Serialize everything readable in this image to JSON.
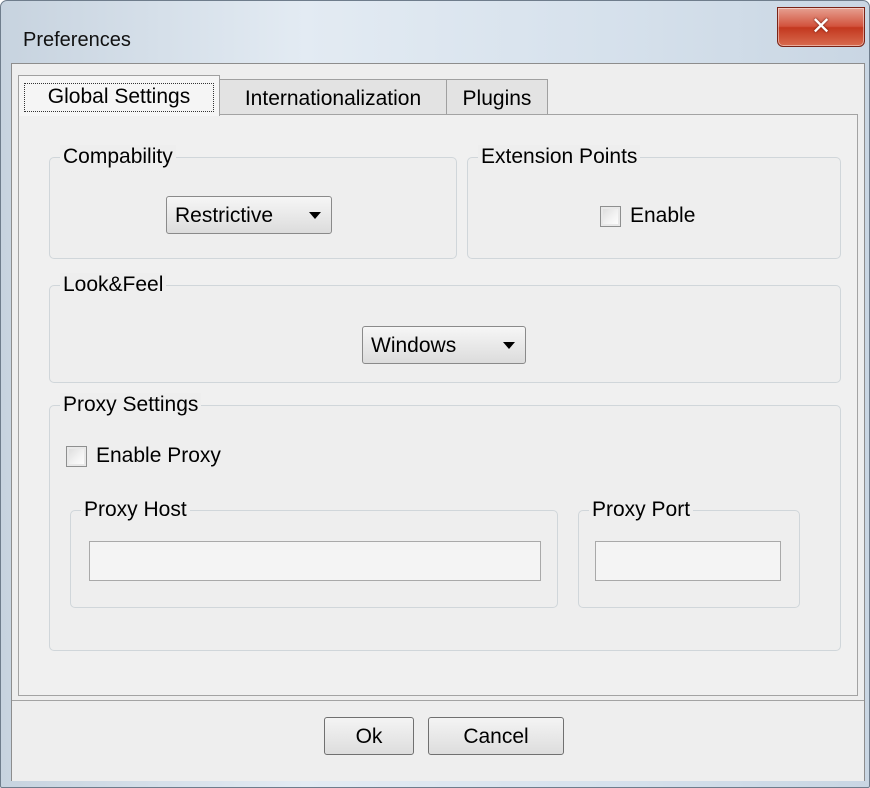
{
  "window": {
    "title": "Preferences",
    "close_glyph": "✕"
  },
  "tabs": [
    {
      "label": "Global Settings",
      "active": true
    },
    {
      "label": "Internationalization",
      "active": false
    },
    {
      "label": "Plugins",
      "active": false
    }
  ],
  "global_settings": {
    "compability": {
      "title": "Compability",
      "selected": "Restrictive"
    },
    "extension_points": {
      "title": "Extension Points",
      "enable_label": "Enable",
      "enable_checked": false
    },
    "look_and_feel": {
      "title": "Look&Feel",
      "selected": "Windows"
    },
    "proxy": {
      "title": "Proxy Settings",
      "enable_label": "Enable Proxy",
      "enable_checked": false,
      "host": {
        "title": "Proxy Host",
        "value": ""
      },
      "port": {
        "title": "Proxy Port",
        "value": ""
      }
    }
  },
  "buttons": {
    "ok": "Ok",
    "cancel": "Cancel"
  },
  "icons": {
    "close": "close-icon",
    "dropdown": "chevron-down-icon",
    "checkbox": "checkbox-unchecked-icon"
  },
  "colors": {
    "close_button": "#c94430",
    "dialog_background": "#eeeeee",
    "title_bar": "#d6e1ec"
  }
}
